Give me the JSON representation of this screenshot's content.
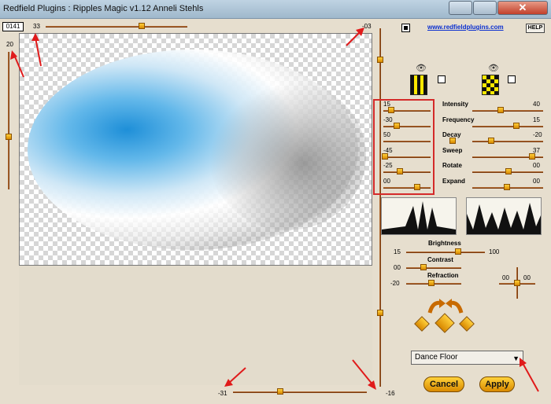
{
  "window": {
    "title": "Redfield Plugins : Ripples Magic v1.12   Anneli Stehls",
    "close_glyph": "✕"
  },
  "frame_counter": "0141",
  "top_slider": {
    "value": "33",
    "right_value": "-03"
  },
  "left_slider": {
    "value": "20"
  },
  "bottom_slider": {
    "value": "-31",
    "right_value": "-16"
  },
  "header": {
    "link": "www.redfieldplugins.com",
    "help": "HELP"
  },
  "params": [
    {
      "value": "15",
      "name": "Intensity",
      "right": "40"
    },
    {
      "value": "-30",
      "name": "Frequency",
      "right": "15"
    },
    {
      "value": "50",
      "name": "Decay",
      "right": "-20"
    },
    {
      "value": "-45",
      "name": "Sweep",
      "right": "37"
    },
    {
      "value": "-25",
      "name": "Rotate",
      "right": "00"
    },
    {
      "value": "00",
      "name": "Expand",
      "right": "00"
    }
  ],
  "light": {
    "brightness_label": "Brightness",
    "brightness_left": "15",
    "brightness_right": "100",
    "contrast_label": "Contrast",
    "contrast_left": "00",
    "refraction_label": "Refraction",
    "refraction_left": "-20",
    "xy_value": "00",
    "xy_value2": "00"
  },
  "preset": "Dance Floor",
  "buttons": {
    "cancel": "Cancel",
    "apply": "Apply"
  },
  "colors": {
    "accent": "#d98a00",
    "slider": "#7b3b10",
    "link": "#0a2fd0",
    "highlight": "#d42a2a"
  }
}
